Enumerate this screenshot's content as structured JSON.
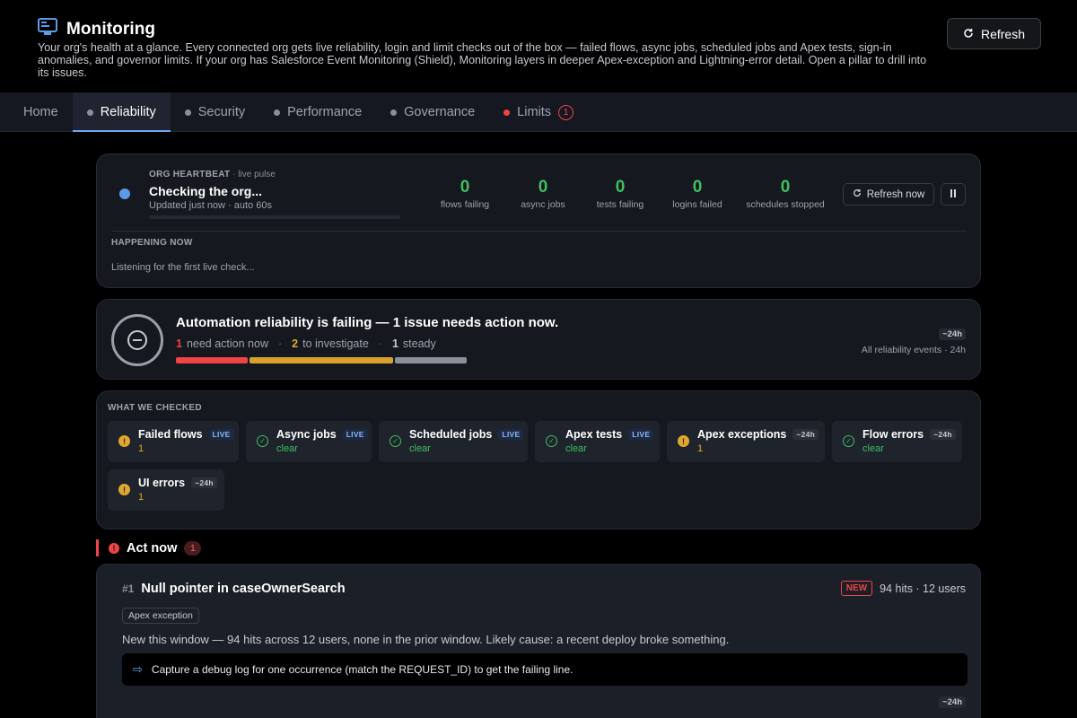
{
  "header": {
    "title": "Monitoring",
    "description": "Your org's health at a glance. Every connected org gets live reliability, login and limit checks out of the box — failed flows, async jobs, scheduled jobs and Apex tests, sign-in anomalies, and governor limits. If your org has Salesforce Event Monitoring (Shield), Monitoring layers in deeper Apex-exception and Lightning-error detail. Open a pillar to drill into its issues.",
    "refresh_label": "Refresh",
    "icon": "monitor-icon"
  },
  "tabs": [
    {
      "label": "Home",
      "dot": false
    },
    {
      "label": "Reliability",
      "dot": true,
      "active": true
    },
    {
      "label": "Security",
      "dot": true
    },
    {
      "label": "Performance",
      "dot": true
    },
    {
      "label": "Governance",
      "dot": true
    },
    {
      "label": "Limits",
      "dot": true,
      "dot_color": "#ef4444",
      "badge": "1"
    }
  ],
  "heartbeat": {
    "label": "ORG HEARTBEAT",
    "label_suffix": "· live pulse",
    "status": "Checking the org...",
    "updated": "Updated just now · auto 60s",
    "stats": [
      {
        "value": "0",
        "label": "flows failing"
      },
      {
        "value": "0",
        "label": "async jobs"
      },
      {
        "value": "0",
        "label": "tests failing"
      },
      {
        "value": "0",
        "label": "logins failed"
      },
      {
        "value": "0",
        "label": "schedules stopped"
      }
    ],
    "refresh_now_label": "Refresh now",
    "happening_now_label": "HAPPENING NOW",
    "listening_text": "Listening for the first live check..."
  },
  "reliability": {
    "title": "Automation reliability is failing — 1 issue needs action now.",
    "need_action_count": "1",
    "need_action_label": "need action now",
    "investigate_count": "2",
    "investigate_label": "to investigate",
    "steady_count": "1",
    "steady_label": "steady",
    "window_tag": "~24h",
    "window_caption": "All reliability events · 24h",
    "bar_segments": [
      {
        "count": 1,
        "color": "#ef4444"
      },
      {
        "count": 2,
        "color": "#d9a12a"
      },
      {
        "count": 1,
        "color": "#8a8f99"
      }
    ]
  },
  "checks": {
    "heading": "WHAT WE CHECKED",
    "items": [
      {
        "name": "Failed flows",
        "tag": "LIVE",
        "status": "1",
        "state": "warn"
      },
      {
        "name": "Async jobs",
        "tag": "LIVE",
        "status": "clear",
        "state": "ok"
      },
      {
        "name": "Scheduled jobs",
        "tag": "LIVE",
        "status": "clear",
        "state": "ok"
      },
      {
        "name": "Apex tests",
        "tag": "LIVE",
        "status": "clear",
        "state": "ok"
      },
      {
        "name": "Apex exceptions",
        "tag": "~24h",
        "status": "1",
        "state": "warn"
      },
      {
        "name": "Flow errors",
        "tag": "~24h",
        "status": "clear",
        "state": "ok"
      },
      {
        "name": "UI errors",
        "tag": "~24h",
        "status": "1",
        "state": "warn"
      }
    ]
  },
  "act_now": {
    "title": "Act now",
    "count": "1"
  },
  "issue": {
    "rank": "#1",
    "title": "Null pointer in caseOwnerSearch",
    "new_label": "NEW",
    "hits": "94 hits · 12 users",
    "pillar_tag": "Apex exception",
    "description": "New this window — 94 hits across 12 users, none in the prior window. Likely cause: a recent deploy broke something.",
    "next_step": "Capture a debug log for one occurrence (match the REQUEST_ID) to get the failing line.",
    "window_tag": "~24h"
  },
  "colors": {
    "ok": "#3fbf5f",
    "warn": "#e0a82e",
    "error": "#ef4444",
    "accent": "#6ea8f0"
  }
}
